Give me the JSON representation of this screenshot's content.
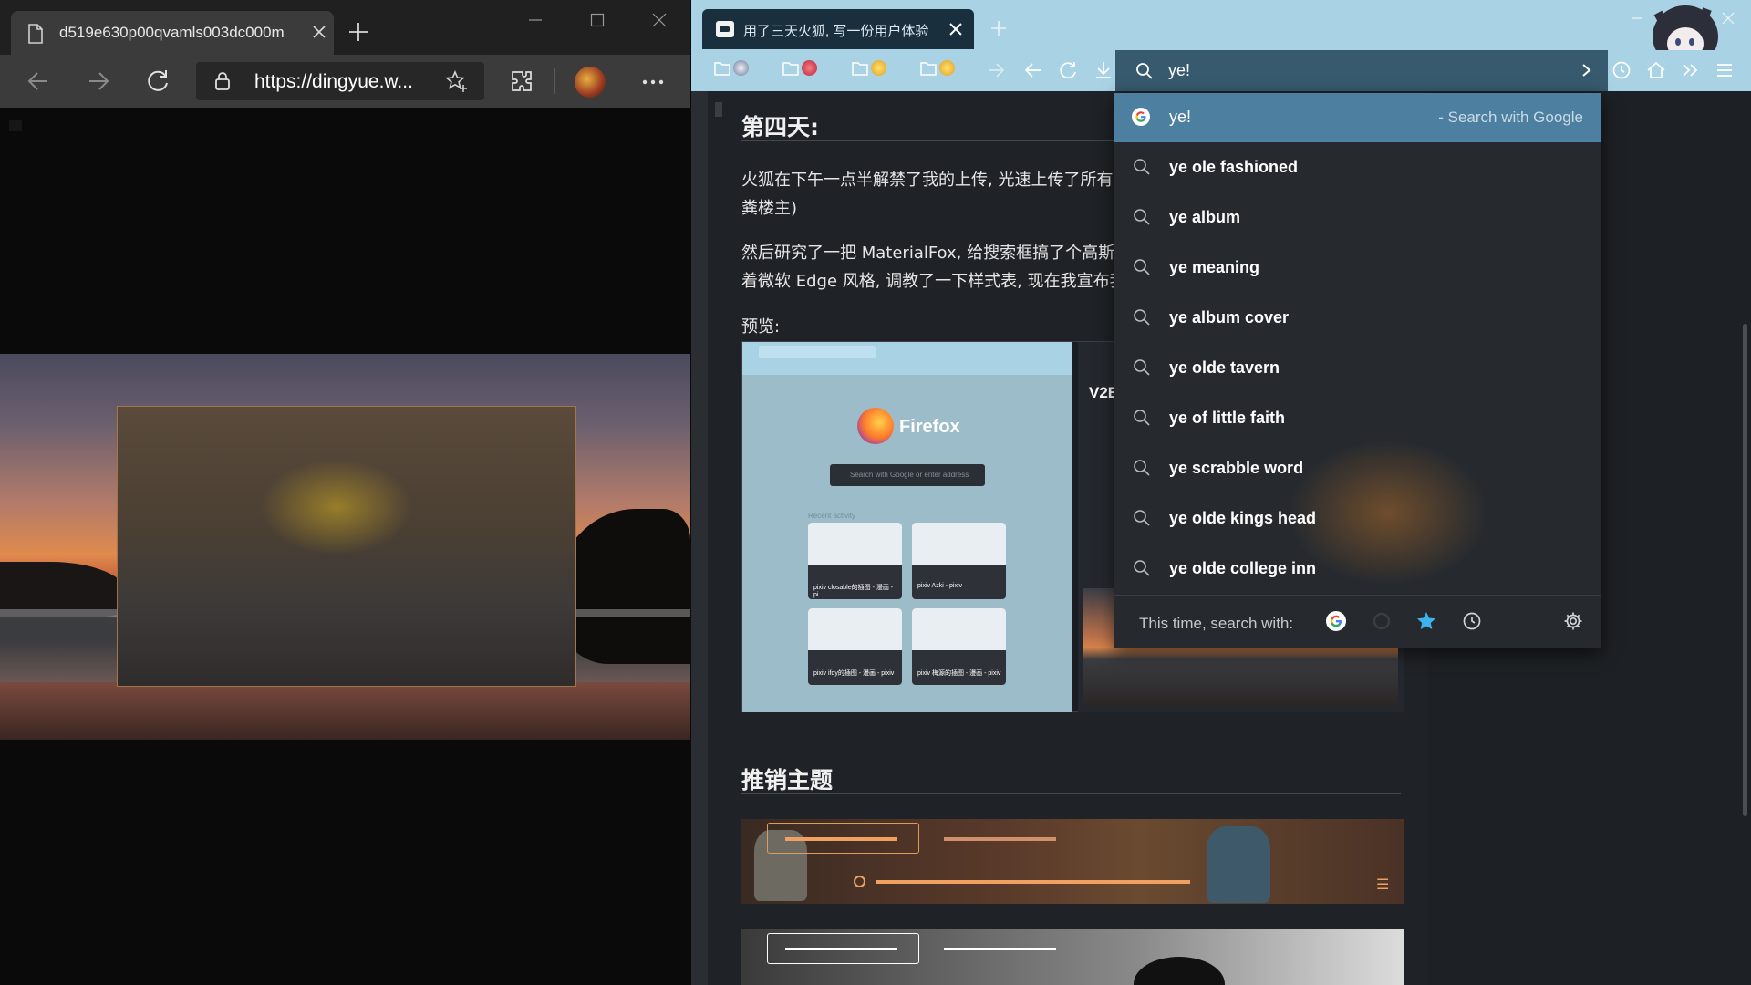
{
  "edge": {
    "tab_title": "d519e630p00qvamls003dc000m",
    "address": "https://dingyue.w...",
    "icons": [
      "document-icon",
      "tab-close-icon",
      "new-tab-icon",
      "minimize-icon",
      "maximize-icon",
      "window-close-icon",
      "back-icon",
      "forward-icon",
      "refresh-icon",
      "lock-icon",
      "add-favorite-icon",
      "extensions-icon",
      "avatar",
      "more-icon"
    ]
  },
  "firefox": {
    "tab_title": "用了三天火狐, 写一份用户体验",
    "urlbar": {
      "value": "ye!"
    },
    "dropdown": {
      "top": {
        "query": "ye!",
        "action": "- Search with Google"
      },
      "suggestions": [
        "ye ole fashioned",
        "ye album",
        "ye meaning",
        "ye album cover",
        "ye olde tavern",
        "ye of little faith",
        "ye scrabble word",
        "ye olde kings head",
        "ye olde college inn"
      ],
      "footer_label": "This time, search with:"
    },
    "article": {
      "heading1": "第四天:",
      "para1": "火狐在下午一点半解禁了我的上传, 光速上传了所有\n粪楼主)",
      "para2": "然后研究了一把 MaterialFox, 给搜索框搞了个高斯模\n着微软 Edge 风格, 调教了一下样式表, 现在我宣布我",
      "preview_label": "预览:",
      "preview": {
        "firefox_name": "Firefox",
        "search_placeholder": "Search with Google or enter address",
        "recent_label": "Recent activity",
        "cards": [
          "pixiv closable的插图 - 漫画 - pi...",
          "pixiv Azki - pixiv",
          "pixiv ifdy的插图 - 漫画 - pixiv",
          "pixiv 梅源的插图 - 漫画 - pixiv"
        ],
        "v2ex": "V2EX"
      },
      "heading2": "推销主题"
    }
  },
  "colors": {
    "ff_chrome": "#a9d2e4",
    "ff_urlbar": "#375a6e",
    "dropdown_bg": "#262a2f",
    "dropdown_highlight": "#4d7fa0",
    "edge_toolbar": "#3b3b3b"
  }
}
